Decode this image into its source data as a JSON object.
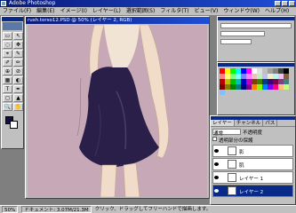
{
  "app": {
    "title": "Adobe Photoshop"
  },
  "menu": [
    "ファイル(F)",
    "編集(E)",
    "イメージ(I)",
    "レイヤー(L)",
    "選択範囲(S)",
    "フィルタ(T)",
    "ビュー(V)",
    "ウィンドウ(W)",
    "ヘルプ(H)"
  ],
  "document": {
    "title": "rush.torso12.PSD @ 50% (レイヤー 2, RGB)"
  },
  "toolbox": {
    "tools": [
      "▭",
      "↖",
      "◌",
      "✥",
      "⌖",
      "✎",
      "✐",
      "✏",
      "⊕",
      "⊘",
      "▦",
      "◐",
      "T",
      "✒",
      "◻",
      "▲",
      "🔍",
      "✋"
    ]
  },
  "palettes": {
    "layers": {
      "tabs": [
        "レイヤー",
        "チャンネル",
        "パス"
      ],
      "mode": "通常",
      "opacity_label": "不透明度",
      "preserve_label": "透明部分の保護",
      "layers": [
        {
          "name": "影",
          "selected": false
        },
        {
          "name": "肌",
          "selected": false
        },
        {
          "name": "レイヤー 1",
          "selected": false
        },
        {
          "name": "レイヤー 2",
          "selected": true
        }
      ]
    },
    "swatches": {
      "colors": [
        "#ff0000",
        "#ffff00",
        "#00ff00",
        "#00ffff",
        "#0000ff",
        "#ff00ff",
        "#ffffff",
        "#e0e0e0",
        "#c0c0c0",
        "#a0a0a0",
        "#808080",
        "#404040",
        "#000000",
        "#ff8080",
        "#ffff80",
        "#80ff80",
        "#80ffff",
        "#8080ff",
        "#ff80ff",
        "#f0c0c0",
        "#c0f0c0",
        "#c0c0f0",
        "#f0f0c0",
        "#c0f0f0",
        "#f0c0f0",
        "#806040",
        "#c00000",
        "#c0c000",
        "#00c000",
        "#00c0c0",
        "#0000c0",
        "#c000c0",
        "#804000",
        "#408000",
        "#004080",
        "#400080",
        "#800040",
        "#804080",
        "#408080",
        "#800000",
        "#808000",
        "#008000",
        "#008080",
        "#000080",
        "#800080",
        "#ff8000",
        "#80ff00",
        "#0080ff",
        "#8000ff",
        "#ff0080",
        "#ffc080",
        "#c0ff80",
        "#80c0ff"
      ]
    }
  },
  "status": {
    "zoom": "50%",
    "doc_info": "ドキュメント: 3.07M/21.3M",
    "hint": "クリック、ドラッグしてフリーハンドで描画します。"
  }
}
